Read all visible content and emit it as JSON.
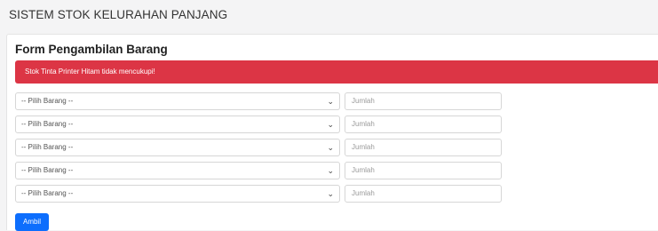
{
  "app": {
    "title": "SISTEM STOK KELURAHAN PANJANG"
  },
  "form": {
    "title": "Form Pengambilan Barang",
    "alert": "Stok Tinta Printer Hitam tidak mencukupi!",
    "rows": [
      {
        "select_value": "-- Pilih Barang --",
        "qty_placeholder": "Jumlah"
      },
      {
        "select_value": "-- Pilih Barang --",
        "qty_placeholder": "Jumlah"
      },
      {
        "select_value": "-- Pilih Barang --",
        "qty_placeholder": "Jumlah"
      },
      {
        "select_value": "-- Pilih Barang --",
        "qty_placeholder": "Jumlah"
      },
      {
        "select_value": "-- Pilih Barang --",
        "qty_placeholder": "Jumlah"
      }
    ],
    "submit_label": "Ambil"
  },
  "icons": {
    "select_arrow": "chevron-down-icon"
  },
  "colors": {
    "alert_bg": "#dc3545",
    "button_bg": "#0d6efd"
  }
}
